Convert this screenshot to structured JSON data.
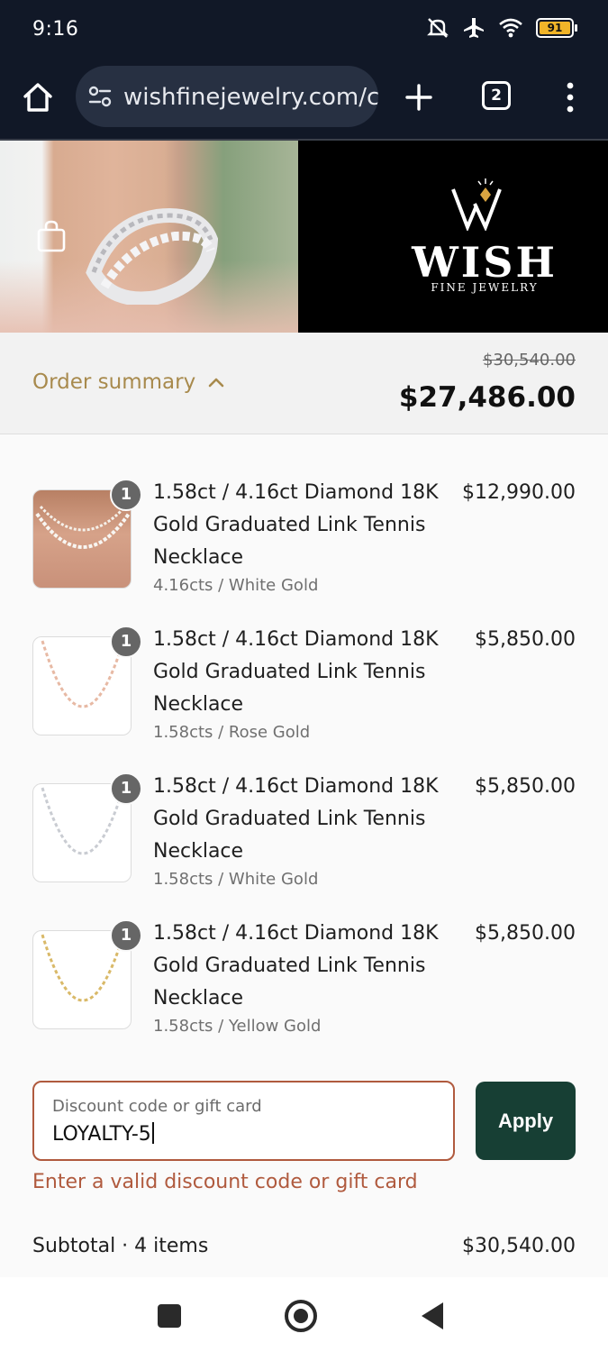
{
  "status_bar": {
    "time": "9:16",
    "battery_level": "91",
    "icons": [
      "mute-vibrate-icon",
      "airplane-icon",
      "wifi-icon",
      "battery-icon"
    ]
  },
  "browser": {
    "url": "wishfinejewelry.com/c",
    "tab_count": "2",
    "icons": [
      "home-icon",
      "site-settings-icon",
      "new-tab-icon",
      "tab-switcher-icon",
      "overflow-menu-icon"
    ]
  },
  "brand": {
    "name": "WISH",
    "tagline": "FINE JEWELRY"
  },
  "summary": {
    "toggle_label": "Order summary",
    "original_total": "$30,540.00",
    "total": "$27,486.00"
  },
  "items": [
    {
      "title": "1.58ct / 4.16ct Diamond 18K Gold Graduated Link Tennis Necklace",
      "variant": "4.16cts / White Gold",
      "price": "$12,990.00",
      "quantity": "1"
    },
    {
      "title": "1.58ct / 4.16ct Diamond 18K Gold Graduated Link Tennis Necklace",
      "variant": "1.58cts / Rose Gold",
      "price": "$5,850.00",
      "quantity": "1"
    },
    {
      "title": "1.58ct / 4.16ct Diamond 18K Gold Graduated Link Tennis Necklace",
      "variant": "1.58cts / White Gold",
      "price": "$5,850.00",
      "quantity": "1"
    },
    {
      "title": "1.58ct / 4.16ct Diamond 18K Gold Graduated Link Tennis Necklace",
      "variant": "1.58cts / Yellow Gold",
      "price": "$5,850.00",
      "quantity": "1"
    }
  ],
  "discount": {
    "placeholder": "Discount code or gift card",
    "value": "LOYALTY-5",
    "apply_label": "Apply",
    "error": "Enter a valid discount code or gift card"
  },
  "subtotal": {
    "label": "Subtotal · 4 items",
    "value": "$30,540.00"
  },
  "colors": {
    "accent_gold": "#a88a4d",
    "error": "#b05a3e",
    "apply_button": "#173f34",
    "toolbar": "#111827"
  }
}
